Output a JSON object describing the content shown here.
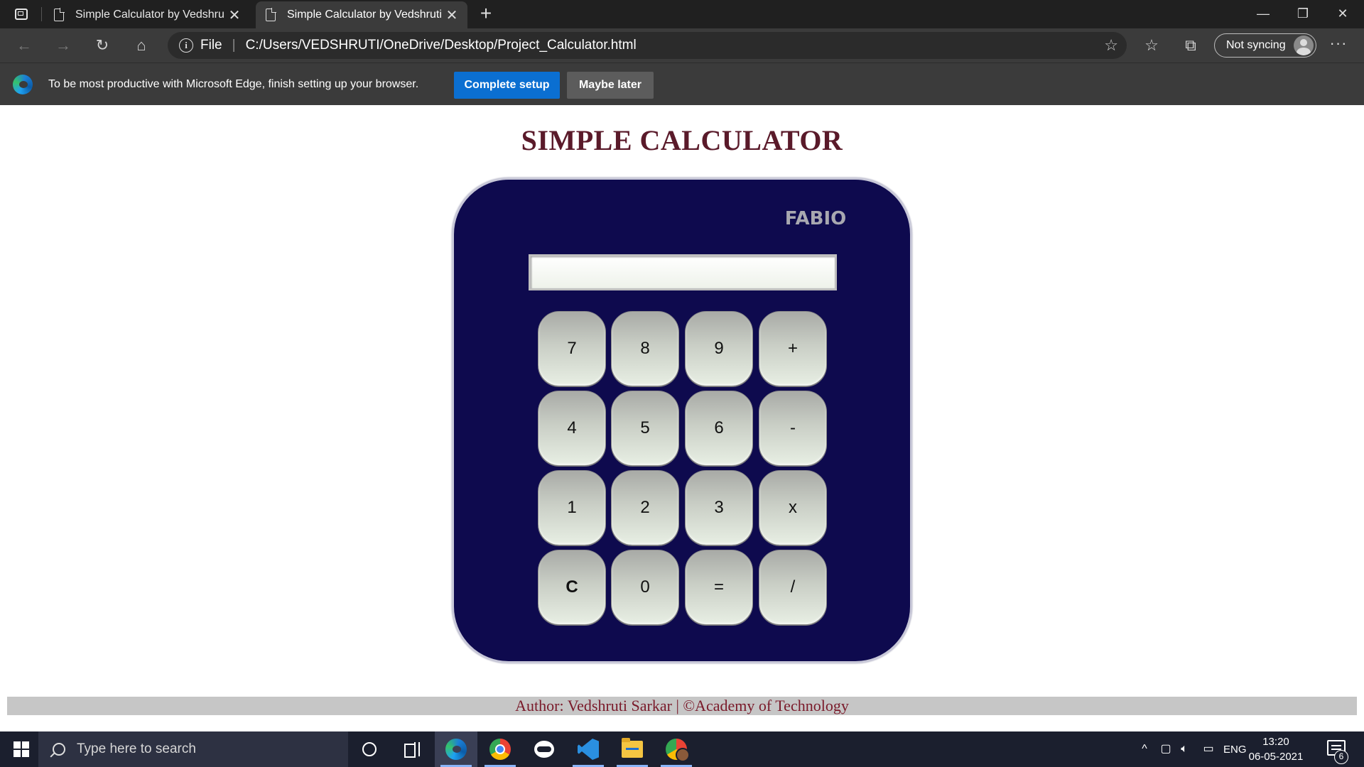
{
  "browser": {
    "tabs": [
      {
        "title": "Simple Calculator by Vedshruti",
        "close": "✕"
      },
      {
        "title": "Simple Calculator by Vedshruti",
        "close": "✕"
      }
    ],
    "new_tab": "+",
    "window_controls": {
      "minimize": "—",
      "restore": "❐",
      "close": "✕"
    },
    "address": {
      "scheme_label": "File",
      "url": "C:/Users/VEDSHRUTI/OneDrive/Desktop/Project_Calculator.html"
    },
    "profile": {
      "label": "Not syncing"
    },
    "more": "···",
    "nav": {
      "back": "←",
      "forward": "→",
      "refresh": "↻",
      "home": "⌂"
    },
    "toolbar_icons": {
      "favorites": "☆",
      "collections": "⧉",
      "add_favorite": "☆"
    }
  },
  "infobar": {
    "message": "To be most productive with Microsoft Edge, finish setting up your browser.",
    "primary_label": "Complete setup",
    "secondary_label": "Maybe later"
  },
  "page": {
    "title": "SIMPLE CALCULATOR",
    "calculator": {
      "brand": "FABIO",
      "display_value": "",
      "keys": [
        [
          "7",
          "8",
          "9",
          "+"
        ],
        [
          "4",
          "5",
          "6",
          "-"
        ],
        [
          "1",
          "2",
          "3",
          "x"
        ],
        [
          "C",
          "0",
          "=",
          "/"
        ]
      ]
    },
    "footer": "Author: Vedshruti Sarkar | ©Academy of Technology"
  },
  "taskbar": {
    "search_placeholder": "Type here to search",
    "tray": {
      "language": "ENG",
      "time": "13:20",
      "date": "06-05-2021",
      "notifications": "6",
      "chevron": "^"
    }
  },
  "colors": {
    "calculator_body": "#0e0a4e",
    "title_color": "#5a1a2a",
    "footer_text": "#7a1a2a",
    "primary_button": "#0b6fd1"
  }
}
